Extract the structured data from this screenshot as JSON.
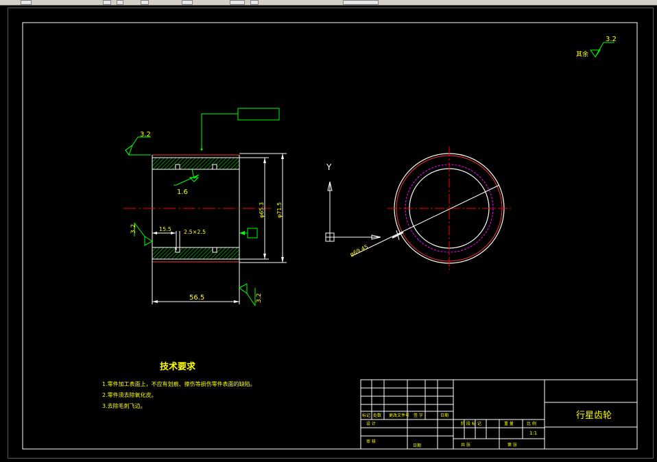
{
  "toolbar": {
    "buttons": [
      "",
      "",
      "",
      "",
      "",
      "",
      "",
      ""
    ]
  },
  "drawing": {
    "roughness": {
      "main": "3.2",
      "left": "3.2",
      "bottom": "3.2",
      "inner": "1.6",
      "top_right_label": "其余",
      "top_right_value": "3.2"
    },
    "dims": {
      "length": "56.5",
      "inner_dia": "φ65.3",
      "outer_dia": "φ71.5",
      "groove_pos": "15.5",
      "groove_size": "2.5×2.5",
      "circle_dia": "φ69.45"
    },
    "axis_y": "Y",
    "tech_title": "技术要求",
    "tech_notes": [
      "1.零件加工表面上，不应有划痕、擦伤等损伤零件表面的缺陷。",
      "2.零件须去除氧化皮。",
      "3.去除毛刺飞边。"
    ],
    "title_block": {
      "part_name": "行星齿轮",
      "scale": "1:1",
      "row_labels": [
        "标记",
        "处数",
        "更改文件号",
        "签  字",
        "日期"
      ],
      "designer": "设  计",
      "reviewer": "审  核",
      "date_label": "日期",
      "stage": "阶 段 标 记",
      "weight": "重  量",
      "ratio": "比 例",
      "total": "共    张",
      "sheet": "第    张"
    }
  },
  "colors": {
    "green": "#00ff00",
    "white": "#ffffff",
    "red": "#ff0000",
    "magenta": "#ff00ff",
    "yellow": "#ffff00"
  }
}
